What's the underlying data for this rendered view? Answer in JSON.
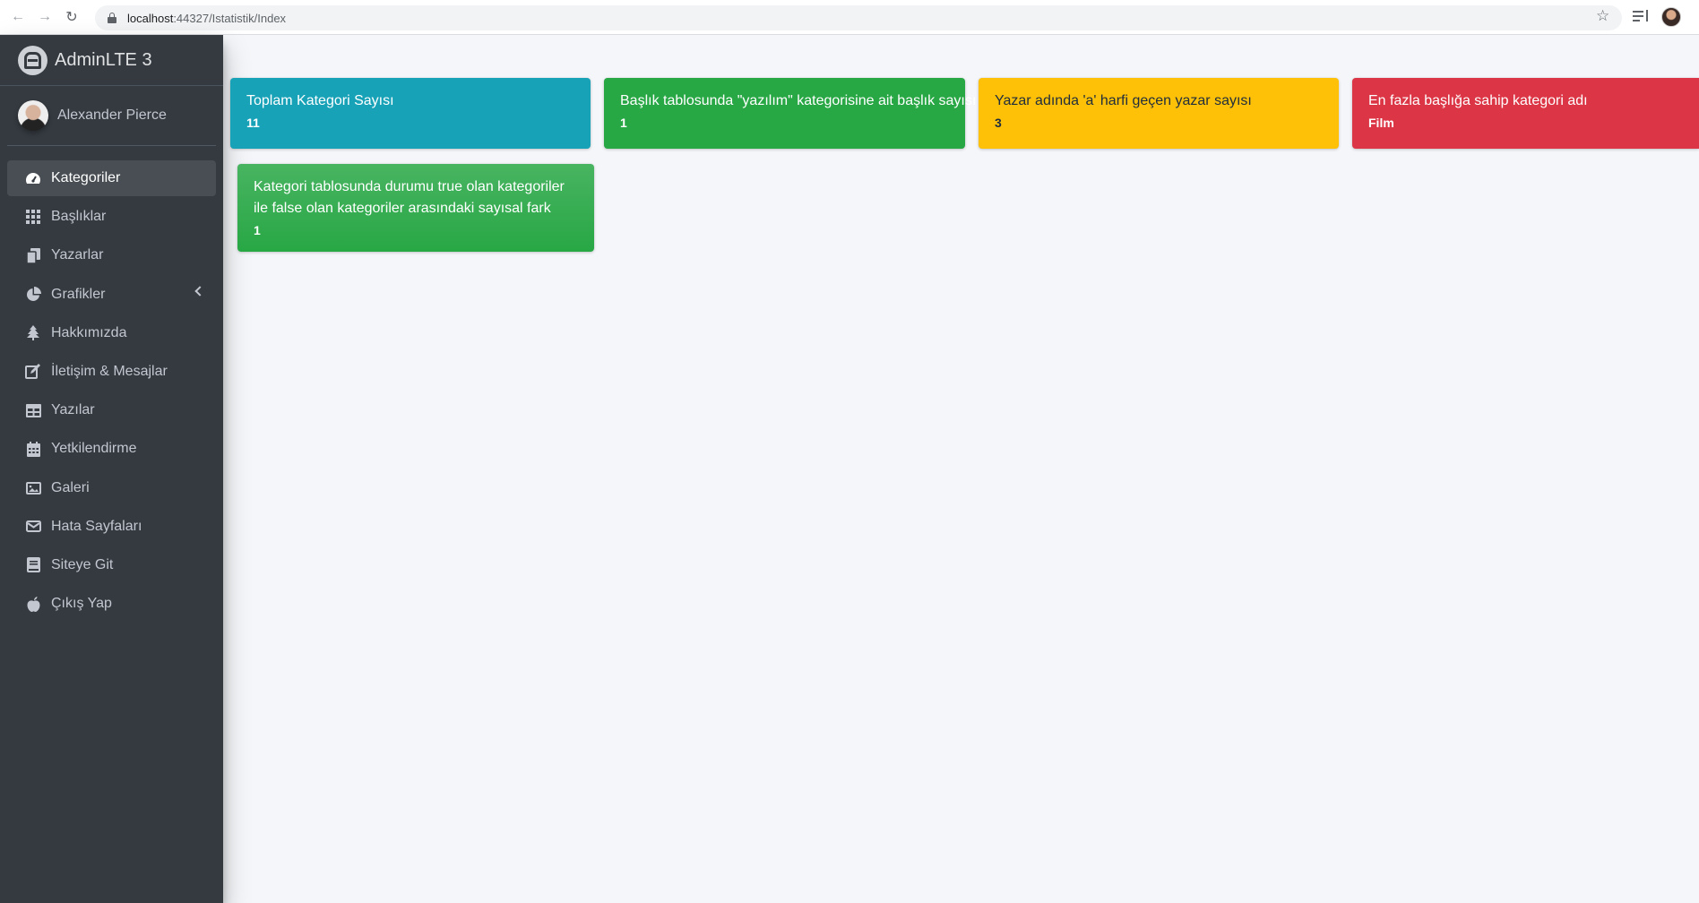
{
  "browser": {
    "url_host": "localhost",
    "url_rest": ":44327/Istatistik/Index"
  },
  "sidebar": {
    "brand": "AdminLTE 3",
    "user_name": "Alexander Pierce",
    "items": [
      {
        "label": "Kategoriler",
        "icon": "tachometer-icon",
        "active": true
      },
      {
        "label": "Başlıklar",
        "icon": "grid-icon"
      },
      {
        "label": "Yazarlar",
        "icon": "copy-icon"
      },
      {
        "label": "Grafikler",
        "icon": "chart-pie-icon",
        "has_arrow": true
      },
      {
        "label": "Hakkımızda",
        "icon": "tree-icon"
      },
      {
        "label": "İletişim & Mesajlar",
        "icon": "edit-icon"
      },
      {
        "label": "Yazılar",
        "icon": "table-icon"
      },
      {
        "label": "Yetkilendirme",
        "icon": "calendar-icon"
      },
      {
        "label": "Galeri",
        "icon": "image-icon"
      },
      {
        "label": "Hata Sayfaları",
        "icon": "envelope-icon"
      },
      {
        "label": "Siteye Git",
        "icon": "book-icon"
      },
      {
        "label": "Çıkış Yap",
        "icon": "apple-icon"
      }
    ]
  },
  "cards": [
    {
      "title": "Toplam Kategori Sayısı",
      "value": "11",
      "color": "#17a2b8"
    },
    {
      "title": "Başlık tablosunda \"yazılım\" kategorisine ait başlık sayısı",
      "value": "1",
      "color": "#28a745"
    },
    {
      "title": "Yazar adında 'a' harfi geçen yazar sayısı",
      "value": "3",
      "color": "#ffc107"
    },
    {
      "title": "En fazla başlığa sahip kategori adı",
      "value": "Film",
      "color": "#dc3545"
    },
    {
      "title": "Kategori tablosunda durumu true olan kategoriler ile false olan kategoriler arasındaki sayısal fark",
      "value": "1",
      "color": "#48b461"
    }
  ]
}
